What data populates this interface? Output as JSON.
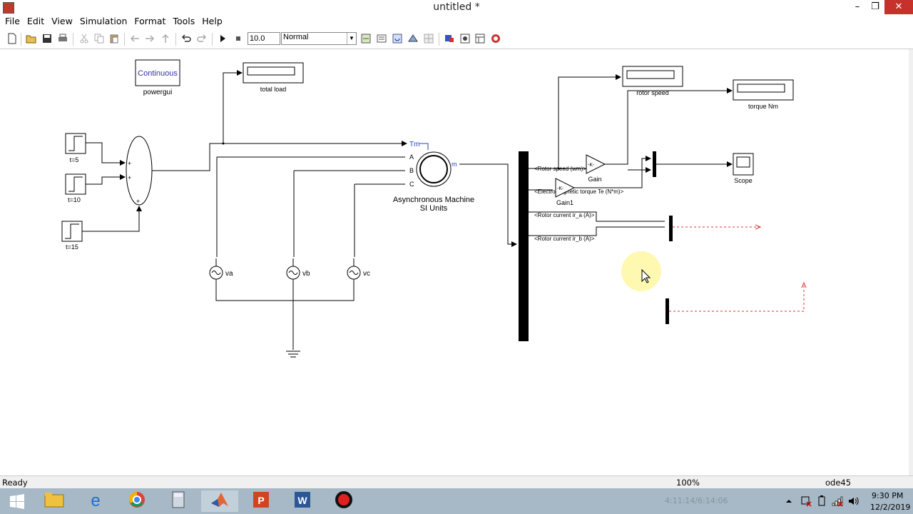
{
  "window": {
    "title": "untitled *",
    "minimize": "–",
    "maximize": "❐",
    "close": "✕"
  },
  "menu": [
    "File",
    "Edit",
    "View",
    "Simulation",
    "Format",
    "Tools",
    "Help"
  ],
  "toolbar": {
    "stop_time": "10.0",
    "sim_mode": "Normal"
  },
  "diagram": {
    "powergui_label": "Continuous",
    "powergui_name": "powergui",
    "step1": "t=5",
    "step2": "t=10",
    "step3": "t=15",
    "total_load": "total load",
    "tm_port": "Tm",
    "port_a": "A",
    "port_b": "B",
    "port_c": "C",
    "m_port": "m",
    "machine_line1": "Asynchronous Machine",
    "machine_line2": "SI Units",
    "va": "va",
    "vb": "vb",
    "vc": "vc",
    "sig_rotor_speed": "<Rotor speed (wm)>",
    "sig_torque": "<Electromagnetic torque Te (N*m)>",
    "sig_ira": "<Rotor current ir_a (A)>",
    "sig_irb": "<Rotor current ir_b (A)>",
    "gain": "Gain",
    "gain1": "Gain1",
    "gain_value": "-K-",
    "rotor_speed": "rotor speed",
    "torque_nm": "torque Nm",
    "scope": "Scope"
  },
  "status": {
    "ready": "Ready",
    "zoom": "100%",
    "solver": "ode45"
  },
  "taskbar": {
    "time": "9:30 PM",
    "date": "12/2/2019",
    "ghost_time": "4:11:14/6:14:06"
  },
  "colors": {
    "taskbar": "#a7b9c6",
    "block_border": "#000000",
    "dashed_line": "#e03030",
    "powergui_text": "#3333aa"
  }
}
